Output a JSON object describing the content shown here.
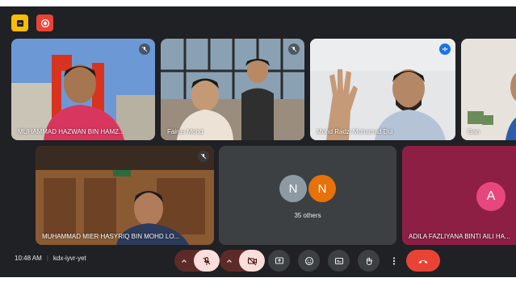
{
  "top_icons": [
    {
      "name": "activities-icon",
      "color": "#fbbc04"
    },
    {
      "name": "recording-icon",
      "color": "#ea4335"
    }
  ],
  "participants": {
    "p1": {
      "name": "MUHAMMAD HAZWAN BIN HAMZ...",
      "muted": true
    },
    "p2": {
      "name": "Fairus Mohd",
      "muted": true
    },
    "p3": {
      "name": "Mohd Radzi Muhamad Dul",
      "speaking": true
    },
    "p4": {
      "name": "Gan"
    },
    "p5": {
      "name": "MUHAMMAD MIER HASYRIQ BIN MOHD LO...",
      "muted": true
    },
    "others": {
      "initials": [
        "N",
        "N"
      ],
      "label": "35 others"
    },
    "p6": {
      "name": "ADILA FAZLIYANA BINTI AILI HA...",
      "initial": "A"
    }
  },
  "meeting": {
    "time": "10:48 AM",
    "code": "kdx-iyvr-yet"
  },
  "controls": [
    {
      "name": "mic-off-button",
      "state": "off"
    },
    {
      "name": "camera-off-button",
      "state": "off"
    },
    {
      "name": "present-button"
    },
    {
      "name": "reactions-button"
    },
    {
      "name": "captions-button"
    },
    {
      "name": "raise-hand-button"
    },
    {
      "name": "more-options-button"
    },
    {
      "name": "leave-call-button"
    }
  ],
  "colors": {
    "background": "#202124",
    "tile": "#3c4043",
    "accent_blue": "#1a73e8",
    "end_call": "#ea4335",
    "avatar_grey": "#8e9aa3",
    "avatar_orange": "#e8710a",
    "avatar_pink": "#e8477e"
  }
}
